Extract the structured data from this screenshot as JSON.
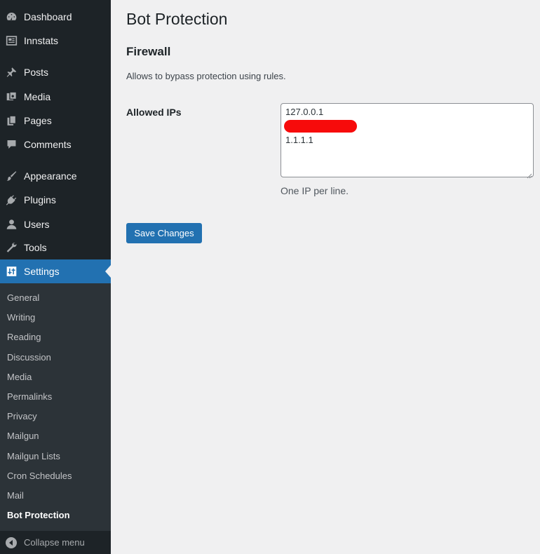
{
  "sidebar": {
    "items": [
      {
        "label": "Dashboard",
        "icon": "dashboard-icon"
      },
      {
        "label": "Innstats",
        "icon": "stats-icon"
      },
      {
        "label": "Posts",
        "icon": "pin-icon"
      },
      {
        "label": "Media",
        "icon": "media-icon"
      },
      {
        "label": "Pages",
        "icon": "pages-icon"
      },
      {
        "label": "Comments",
        "icon": "comments-icon"
      },
      {
        "label": "Appearance",
        "icon": "paintbrush-icon"
      },
      {
        "label": "Plugins",
        "icon": "plugins-icon"
      },
      {
        "label": "Users",
        "icon": "users-icon"
      },
      {
        "label": "Tools",
        "icon": "wrench-icon"
      },
      {
        "label": "Settings",
        "icon": "settings-icon"
      }
    ],
    "settings_submenu": [
      "General",
      "Writing",
      "Reading",
      "Discussion",
      "Media",
      "Permalinks",
      "Privacy",
      "Mailgun",
      "Mailgun Lists",
      "Cron Schedules",
      "Mail",
      "Bot Protection"
    ],
    "collapse_label": "Collapse menu"
  },
  "page": {
    "title": "Bot Protection",
    "section_title": "Firewall",
    "description": "Allows to bypass protection using rules.",
    "field_label": "Allowed IPs",
    "ip_lines": [
      "127.0.0.1",
      "1.1.1.1"
    ],
    "help_text": "One IP per line.",
    "save_label": "Save Changes"
  },
  "colors": {
    "sidebar_bg": "#1d2327",
    "submenu_bg": "#2c3338",
    "accent": "#2271b1",
    "redaction": "#f70b0b"
  }
}
